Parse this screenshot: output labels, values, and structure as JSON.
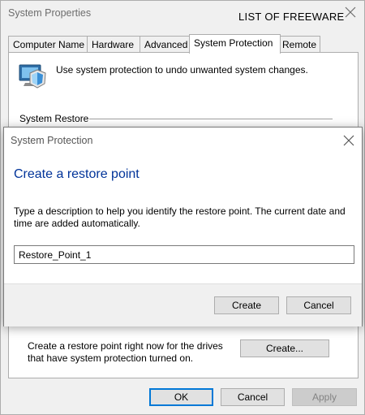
{
  "system_properties": {
    "title": "System Properties",
    "watermark": "LIST OF FREEWARE",
    "tabs": [
      {
        "label": "Computer Name"
      },
      {
        "label": "Hardware"
      },
      {
        "label": "Advanced"
      },
      {
        "label": "System Protection"
      },
      {
        "label": "Remote"
      }
    ],
    "active_tab": "System Protection",
    "description": "Use system protection to undo unwanted system changes.",
    "system_restore_label": "System Restore",
    "create_description": "Create a restore point right now for the drives that have system protection turned on.",
    "create_button": "Create...",
    "buttons": {
      "ok": "OK",
      "cancel": "Cancel",
      "apply": "Apply"
    }
  },
  "dialog": {
    "title": "System Protection",
    "heading": "Create a restore point",
    "description": "Type a description to help you identify the restore point. The current date and time are added automatically.",
    "input_value": "Restore_Point_1",
    "create_button": "Create",
    "cancel_button": "Cancel"
  },
  "colors": {
    "heading_blue": "#003399",
    "focus_blue": "#0078d7"
  },
  "icons": [
    "close-icon",
    "system-protection-icon"
  ]
}
